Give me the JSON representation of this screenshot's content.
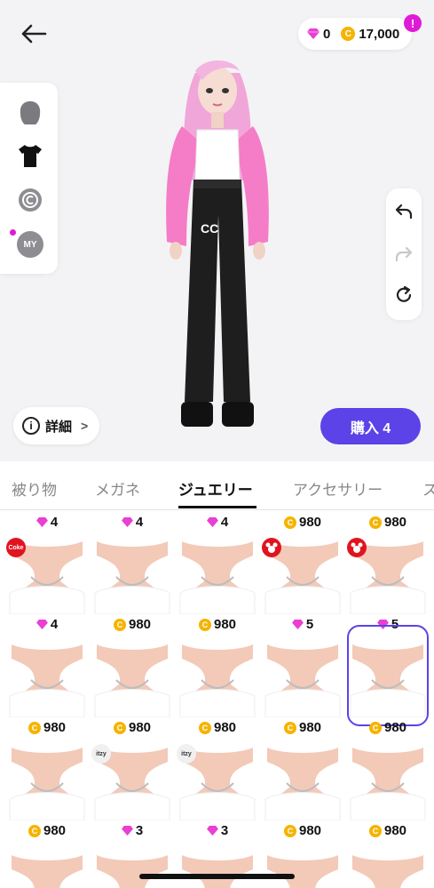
{
  "header": {
    "gem_count": "0",
    "coin_count": "17,000",
    "alert": "!"
  },
  "left_panel": {
    "items": [
      {
        "icon": "hair-icon"
      },
      {
        "icon": "tshirt-icon"
      },
      {
        "icon": "copyright-icon"
      },
      {
        "icon": "my-icon",
        "label": "MY"
      }
    ]
  },
  "actions": {
    "details_label": "詳細",
    "details_chevron": ">",
    "buy_label": "購入 4"
  },
  "tabs": [
    {
      "label": "被り物",
      "active": false
    },
    {
      "label": "メガネ",
      "active": false
    },
    {
      "label": "ジュエリー",
      "active": true
    },
    {
      "label": "アクセサリー",
      "active": false
    },
    {
      "label": "ス",
      "active": false
    }
  ],
  "top_prices": [
    {
      "type": "gem",
      "value": "4"
    },
    {
      "type": "gem",
      "value": "4"
    },
    {
      "type": "gem",
      "value": "4"
    },
    {
      "type": "coin",
      "value": "980"
    },
    {
      "type": "coin",
      "value": "980"
    }
  ],
  "rows": [
    [
      {
        "type": "gem",
        "value": "4",
        "badge": "Coke"
      },
      {
        "type": "coin",
        "value": "980"
      },
      {
        "type": "coin",
        "value": "980"
      },
      {
        "type": "gem",
        "value": "5",
        "badge": "mickey"
      },
      {
        "type": "gem",
        "value": "5",
        "badge": "mickey"
      }
    ],
    [
      {
        "type": "coin",
        "value": "980"
      },
      {
        "type": "coin",
        "value": "980"
      },
      {
        "type": "coin",
        "value": "980"
      },
      {
        "type": "coin",
        "value": "980"
      },
      {
        "type": "coin",
        "value": "980",
        "selected": true
      }
    ],
    [
      {
        "type": "coin",
        "value": "980"
      },
      {
        "type": "gem",
        "value": "3",
        "badge": "itzy"
      },
      {
        "type": "gem",
        "value": "3",
        "badge": "itzy"
      },
      {
        "type": "coin",
        "value": "980"
      },
      {
        "type": "coin",
        "value": "980"
      }
    ]
  ],
  "coin_symbol": "C",
  "colors": {
    "accent": "#5b43e8",
    "gem": "#e93fd3",
    "coin": "#f5b400",
    "alert": "#e01ad6"
  }
}
